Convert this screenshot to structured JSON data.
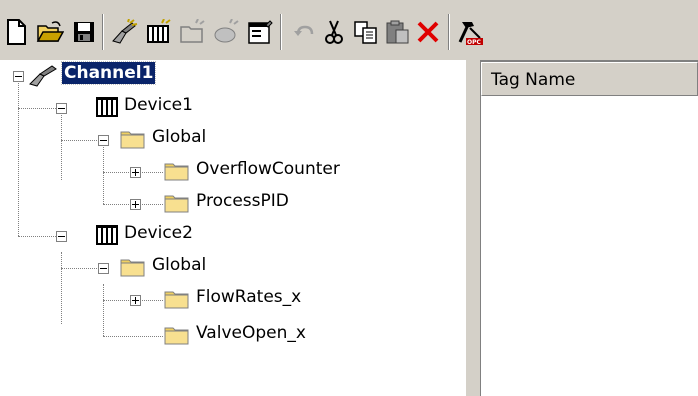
{
  "toolbar": {
    "buttons": [
      {
        "name": "new-button",
        "icon": "new-document-icon"
      },
      {
        "name": "open-button",
        "icon": "open-folder-icon"
      },
      {
        "name": "save-button",
        "icon": "save-disk-icon"
      },
      {
        "name": "new-channel-button",
        "icon": "new-channel-icon"
      },
      {
        "name": "new-device-button",
        "icon": "new-device-icon"
      },
      {
        "name": "new-tag-group-button",
        "icon": "new-tag-group-icon"
      },
      {
        "name": "new-tag-button",
        "icon": "new-tag-icon"
      },
      {
        "name": "properties-button",
        "icon": "properties-icon"
      },
      {
        "name": "undo-button",
        "icon": "undo-icon"
      },
      {
        "name": "cut-button",
        "icon": "scissors-icon"
      },
      {
        "name": "copy-button",
        "icon": "copy-icon"
      },
      {
        "name": "paste-button",
        "icon": "paste-icon"
      },
      {
        "name": "delete-button",
        "icon": "delete-x-icon"
      },
      {
        "name": "opc-quick-client-button",
        "icon": "opc-hammer-icon"
      }
    ]
  },
  "tree": {
    "channel1": "Channel1",
    "device1": "Device1",
    "device1_global": "Global",
    "overflow_counter": "OverflowCounter",
    "process_pid": "ProcessPID",
    "device2": "Device2",
    "device2_global": "Global",
    "flow_rates": "FlowRates_x",
    "valve_open": "ValveOpen_x"
  },
  "list": {
    "columns": [
      "Tag Name"
    ]
  },
  "colors": {
    "selection": "#0a246a",
    "folder": "#f0d060",
    "window": "#d4d0c8"
  }
}
